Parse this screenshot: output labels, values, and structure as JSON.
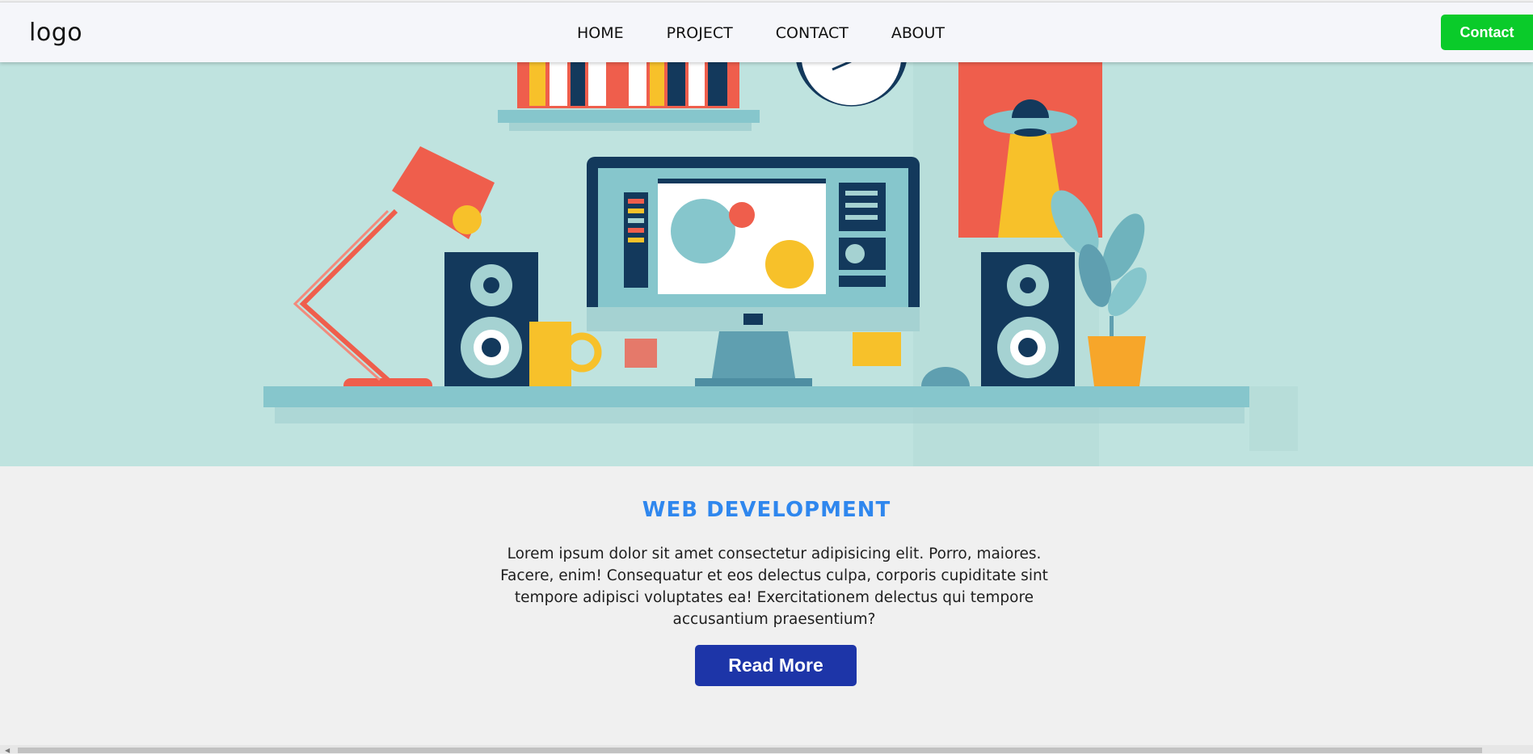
{
  "header": {
    "logo": "logo",
    "nav": [
      "HOME",
      "PROJECT",
      "CONTACT",
      "ABOUT"
    ],
    "contact_label": "Contact",
    "contact_color": "#0acb2a"
  },
  "hero": {
    "image": "flat illustration of a desk setup with monitor, lamp, speakers, plant and shelf",
    "background": "#bfe3df"
  },
  "content": {
    "title": "WEB DEVELOPMENT",
    "title_color": "#2f87ee",
    "description": "Lorem ipsum dolor sit amet consectetur adipisicing elit. Porro, maiores. Facere, enim! Consequatur et eos delectus culpa, corporis cupiditate sint tempore adipisci voluptates ea! Exercitationem delectus qui tempore accusantium praesentium?",
    "read_more_label": "Read More",
    "read_more_color": "#1d35a8"
  }
}
